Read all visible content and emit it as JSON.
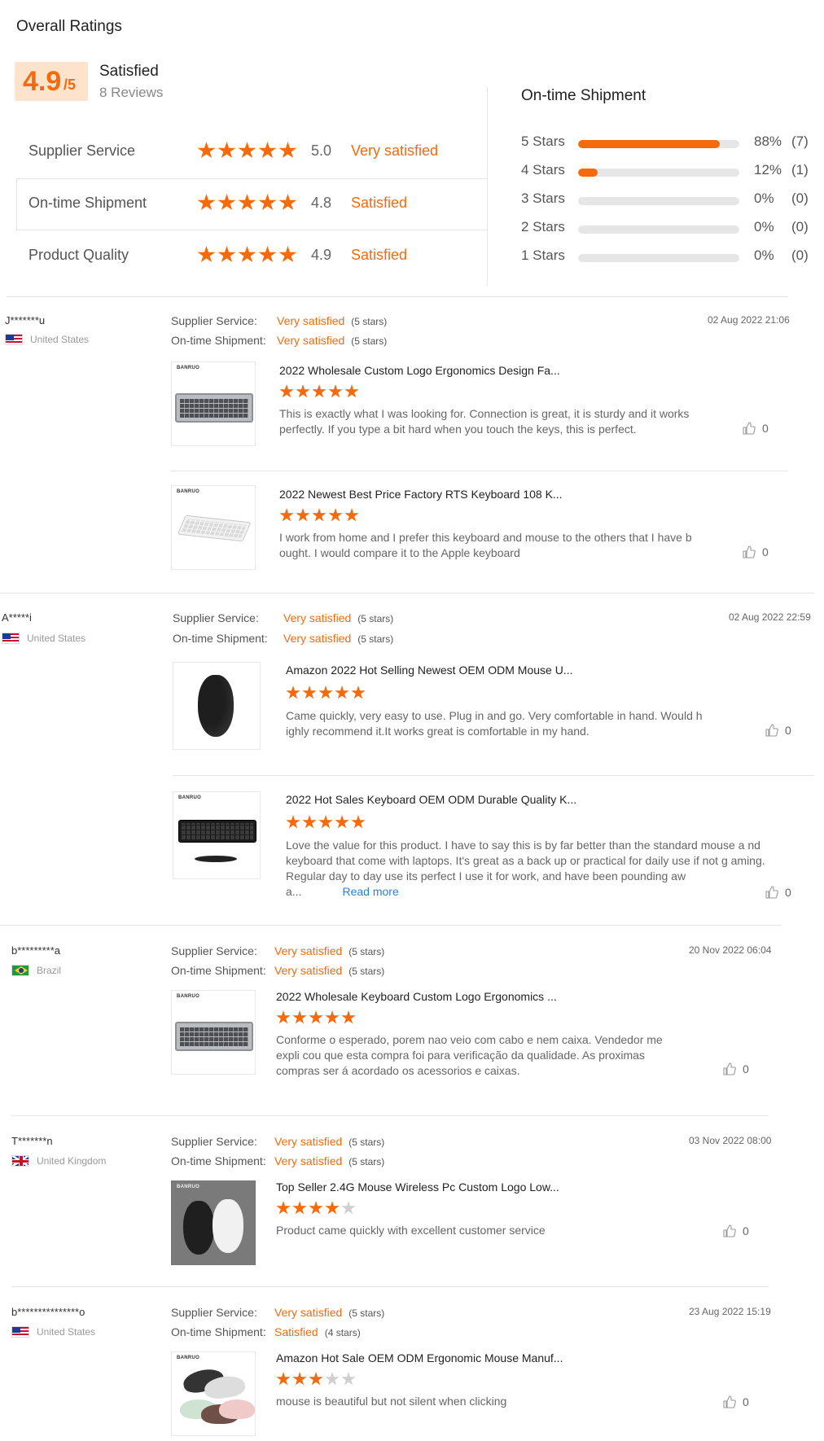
{
  "header": {
    "title": "Overall Ratings",
    "score": "4.9",
    "score_denominator": "/5",
    "summary_label": "Satisfied",
    "review_count": "8 Reviews"
  },
  "metrics": [
    {
      "label": "Supplier Service",
      "value": "5.0",
      "status": "Very satisfied",
      "stars": 5
    },
    {
      "label": "On-time Shipment",
      "value": "4.8",
      "status": "Satisfied",
      "stars": 5
    },
    {
      "label": "Product Quality",
      "value": "4.9",
      "status": "Satisfied",
      "stars": 5
    }
  ],
  "distribution": {
    "title": "On-time Shipment",
    "rows": [
      {
        "label": "5 Stars",
        "percent": "88%",
        "count": "(7)",
        "fill": 0.88
      },
      {
        "label": "4 Stars",
        "percent": "12%",
        "count": "(1)",
        "fill": 0.12
      },
      {
        "label": "3 Stars",
        "percent": "0%",
        "count": "(0)",
        "fill": 0
      },
      {
        "label": "2 Stars",
        "percent": "0%",
        "count": "(0)",
        "fill": 0
      },
      {
        "label": "1 Stars",
        "percent": "0%",
        "count": "(0)",
        "fill": 0
      }
    ]
  },
  "labels": {
    "supplier_service": "Supplier Service:",
    "ontime_shipment": "On-time Shipment:",
    "brand": "BANRUO",
    "read_more": "Read more"
  },
  "colors": {
    "accent": "#f56a0d",
    "accent_bg": "#fde3cc",
    "link": "#2d7fd6"
  },
  "reviews": [
    {
      "user": "J*******u",
      "country": "United States",
      "flag": "us",
      "supplier_status": "Very satisfied",
      "supplier_stars": "(5 stars)",
      "shipment_status": "Very satisfied",
      "shipment_stars": "(5 stars)",
      "date": "02 Aug 2022 21:06",
      "products": [
        {
          "title": "2022 Wholesale Custom Logo Ergonomics Design Fa...",
          "stars": 5,
          "text": "This is exactly what I was looking for. Connection is great, it is sturdy and it works perfectly. If you type a bit hard when you touch the keys, this is perfect.",
          "likes": "0"
        },
        {
          "title": "2022 Newest Best Price Factory RTS Keyboard 108 K...",
          "stars": 5,
          "text": "I work from home and I prefer this keyboard and mouse to the others that I have b ought. I would compare it to the Apple keyboard",
          "likes": "0"
        }
      ]
    },
    {
      "user": "A*****i",
      "country": "United States",
      "flag": "us",
      "supplier_status": "Very satisfied",
      "supplier_stars": "(5 stars)",
      "shipment_status": "Very satisfied",
      "shipment_stars": "(5 stars)",
      "date": "02 Aug 2022 22:59",
      "products": [
        {
          "title": "Amazon 2022 Hot Selling Newest OEM ODM Mouse U...",
          "stars": 5,
          "text": "Came quickly, very easy to use. Plug in and go. Very comfortable in hand. Would h ighly recommend it.It works great is comfortable in my hand.",
          "likes": "0"
        },
        {
          "title": "2022 Hot Sales Keyboard OEM ODM Durable Quality K...",
          "stars": 5,
          "text": "Love the value for this product. I have to say this is by far better than the standard mouse a nd keyboard that come with laptops. It's great as a back up or practical for daily use if not g aming. Regular day to day use its perfect I use it for work, and have been pounding aw a...",
          "likes": "0"
        }
      ]
    },
    {
      "user": "b*********a",
      "country": "Brazil",
      "flag": "br",
      "supplier_status": "Very satisfied",
      "supplier_stars": "(5 stars)",
      "shipment_status": "Very satisfied",
      "shipment_stars": "(5 stars)",
      "date": "20 Nov 2022 06:04",
      "products": [
        {
          "title": "2022 Wholesale Keyboard Custom Logo Ergonomics ...",
          "stars": 5,
          "text": "Conforme o esperado, porem nao veio com cabo e nem caixa. Vendedor me expli cou que esta compra foi para verificação da qualidade. As proximas compras ser á acordado os acessorios e caixas.",
          "likes": "0"
        }
      ]
    },
    {
      "user": "T*******n",
      "country": "United Kingdom",
      "flag": "uk",
      "supplier_status": "Very satisfied",
      "supplier_stars": "(5 stars)",
      "shipment_status": "Very satisfied",
      "shipment_stars": "(5 stars)",
      "date": "03 Nov 2022 08:00",
      "products": [
        {
          "title": "Top Seller 2.4G Mouse Wireless Pc Custom Logo Low...",
          "stars": 4,
          "text": "Product came quickly with excellent customer service",
          "likes": "0"
        }
      ]
    },
    {
      "user": "b***************o",
      "country": "United States",
      "flag": "us",
      "supplier_status": "Very satisfied",
      "supplier_stars": "(5 stars)",
      "shipment_status": "Satisfied",
      "shipment_stars": "(4 stars)",
      "date": "23 Aug 2022 15:19",
      "products": [
        {
          "title": "Amazon Hot Sale OEM ODM Ergonomic Mouse Manuf...",
          "stars": 3,
          "text": "mouse is beautiful but not silent when clicking",
          "likes": "0"
        }
      ]
    }
  ]
}
